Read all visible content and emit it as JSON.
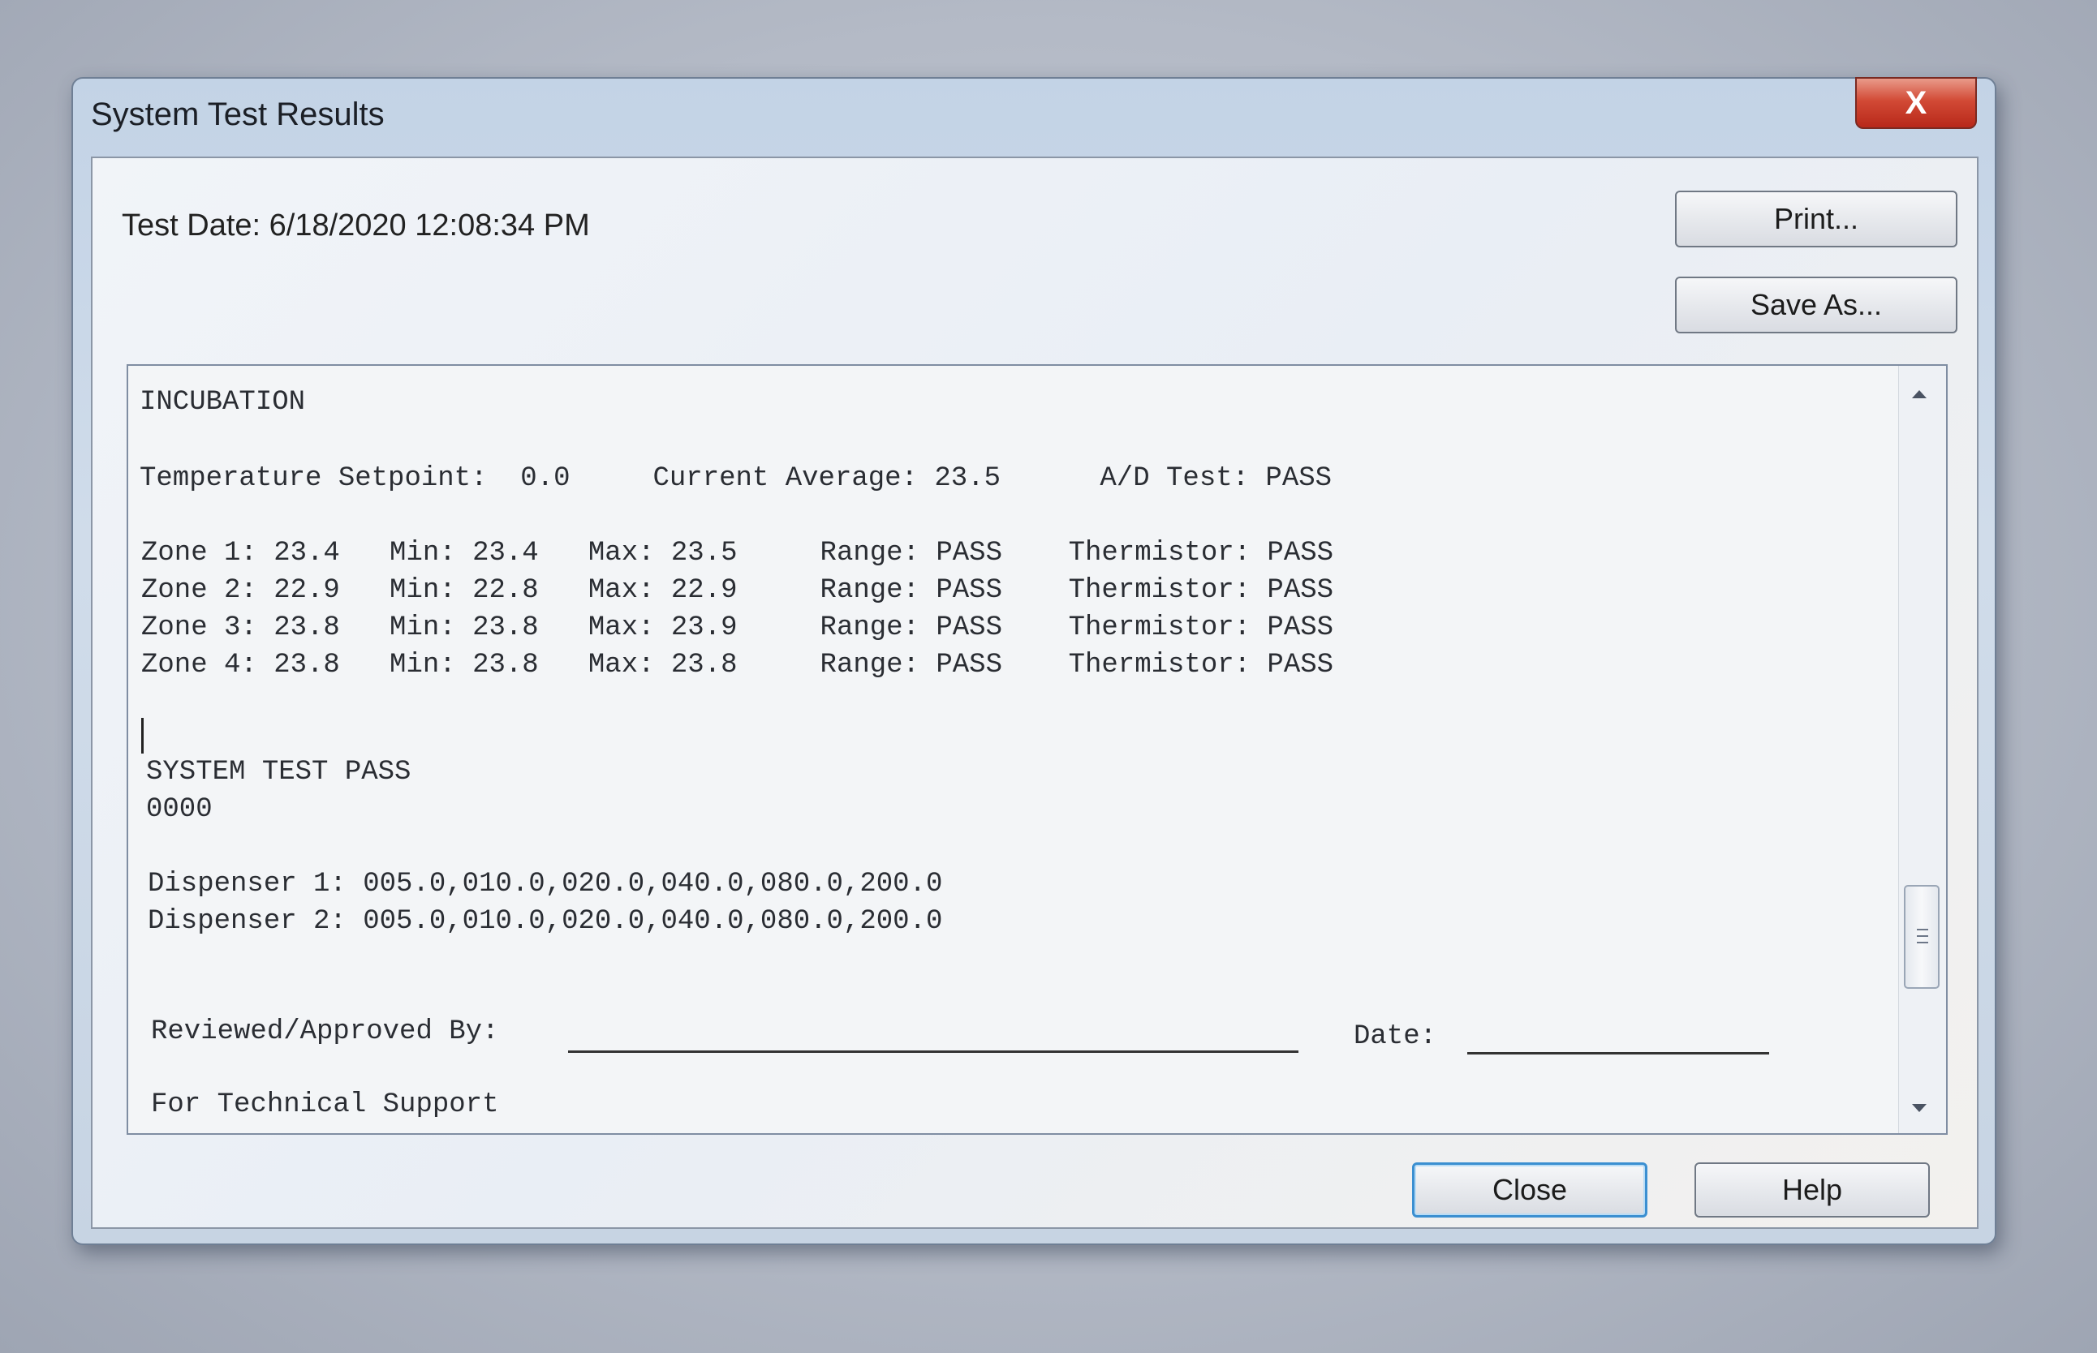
{
  "window": {
    "title": "System Test Results",
    "close_label": "X"
  },
  "header": {
    "test_date": "Test Date: 6/18/2020 12:08:34 PM"
  },
  "toolbar": {
    "print_label": "Print...",
    "save_as_label": "Save As..."
  },
  "report": {
    "section_title": "INCUBATION",
    "setpoint": "Temperature Setpoint:  0.0     Current Average: 23.5      A/D Test: PASS",
    "zones": [
      "Zone 1: 23.4   Min: 23.4   Max: 23.5     Range: PASS    Thermistor: PASS",
      "Zone 2: 22.9   Min: 22.8   Max: 22.9     Range: PASS    Thermistor: PASS",
      "Zone 3: 23.8   Min: 23.8   Max: 23.9     Range: PASS    Thermistor: PASS",
      "Zone 4: 23.8   Min: 23.8   Max: 23.8     Range: PASS    Thermistor: PASS"
    ],
    "system_result": "SYSTEM TEST PASS",
    "code": "0000",
    "dispensers": [
      "Dispenser 1: 005.0,010.0,020.0,040.0,080.0,200.0",
      "Dispenser 2: 005.0,010.0,020.0,040.0,080.0,200.0"
    ],
    "reviewed_label": "Reviewed/Approved By:",
    "date_label": "Date:",
    "support_label": "For Technical Support"
  },
  "footer": {
    "close_label": "Close",
    "help_label": "Help"
  }
}
